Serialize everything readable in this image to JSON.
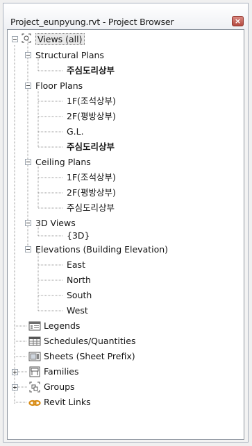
{
  "window": {
    "title": "Project_eunpyung.rvt - Project Browser",
    "close_glyph": "×"
  },
  "tree": {
    "views_root": "Views (all)",
    "structural_plans": {
      "label": "Structural Plans",
      "items": [
        "주심도리상부"
      ]
    },
    "floor_plans": {
      "label": "Floor Plans",
      "items": [
        "1F(조석상부)",
        "2F(평방상부)",
        "G.L.",
        "주심도리상부"
      ]
    },
    "ceiling_plans": {
      "label": "Ceiling Plans",
      "items": [
        "1F(조석상부)",
        "2F(평방상부)",
        "주심도리상부"
      ]
    },
    "views_3d": {
      "label": "3D Views",
      "items": [
        "{3D}"
      ]
    },
    "elevations": {
      "label": "Elevations (Building Elevation)",
      "items": [
        "East",
        "North",
        "South",
        "West"
      ]
    },
    "legends": "Legends",
    "schedules": "Schedules/Quantities",
    "sheets": "Sheets (Sheet Prefix)",
    "families": "Families",
    "groups": "Groups",
    "revit_links": "Revit Links"
  }
}
